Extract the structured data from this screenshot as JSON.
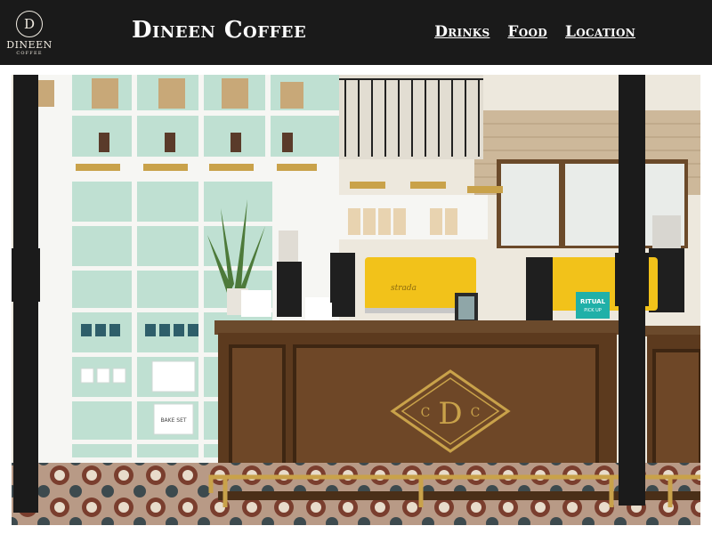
{
  "header": {
    "logo": {
      "letter": "D",
      "name": "DINEEN",
      "sub": "COFFEE"
    },
    "brand": "Dineen Coffee",
    "nav": [
      {
        "label": "Drinks"
      },
      {
        "label": "Food"
      },
      {
        "label": "Location"
      }
    ]
  },
  "hero": {
    "counter_monogram": {
      "left": "C",
      "center": "D",
      "right": "C"
    },
    "sign_text": "RITUAL",
    "sign_sub": "PICK UP",
    "machine_brand": "strada",
    "box_label": "BAKE SET"
  },
  "colors": {
    "header_bg": "#1a1a1a",
    "wood": "#5c3a1e",
    "brass": "#c9a24a",
    "espresso_yellow": "#f2c21a",
    "shelf_mint": "#bfe0d2"
  }
}
